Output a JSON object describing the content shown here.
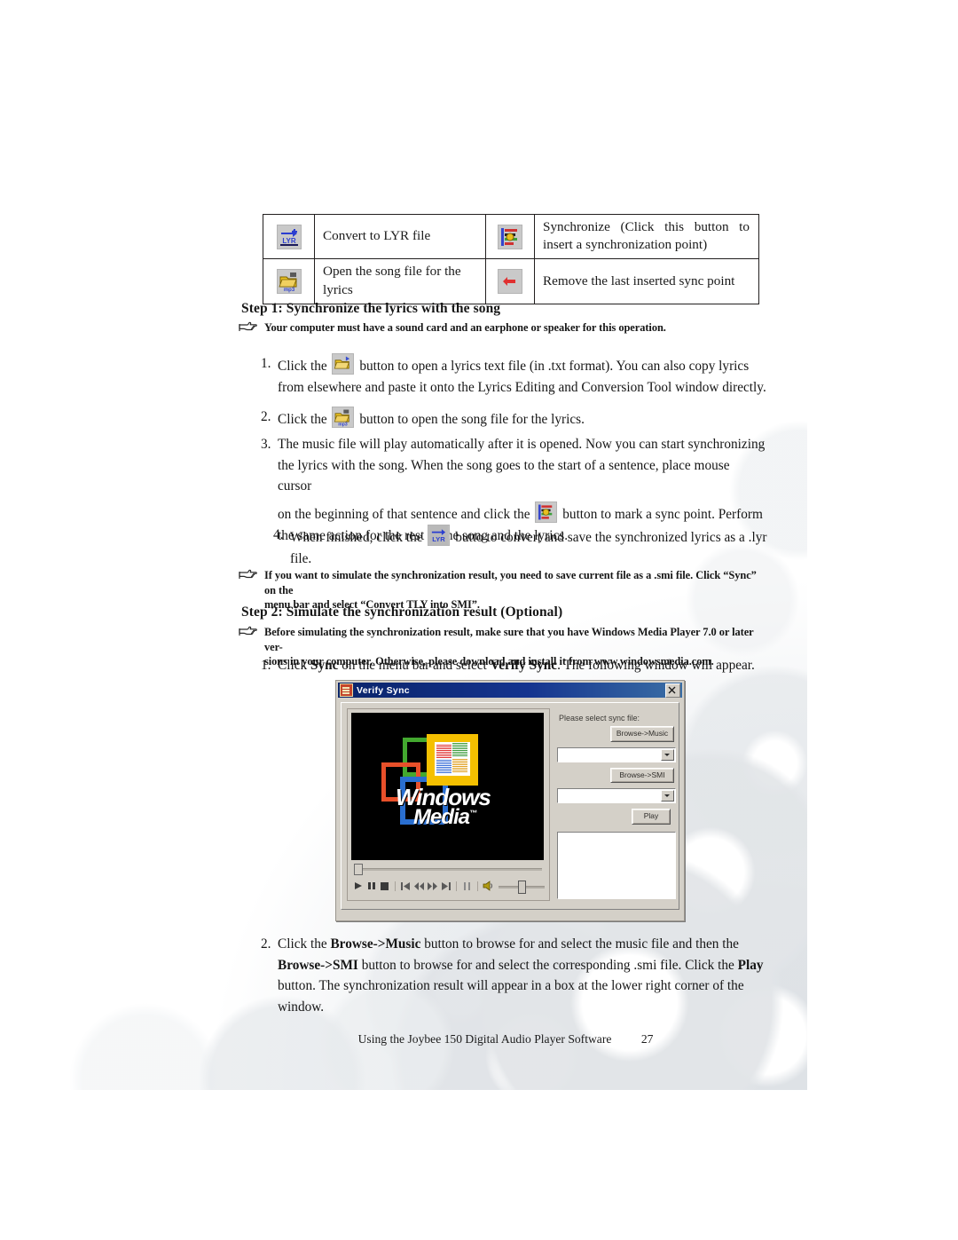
{
  "document": {
    "footer_text": "Using the Joybee 150 Digital Audio Player Software",
    "page_number": "27"
  },
  "icon_table": {
    "rows": [
      {
        "icon_left": "convert-to-lyr-icon",
        "text_left": "Convert to LYR file",
        "icon_right": "synchronize-icon",
        "text_right_line1": "Synchronize (Click this button to",
        "text_right_line2": "insert a synchronization point)"
      },
      {
        "icon_left": "open-song-file-icon",
        "text_left": "Open the song file for the lyrics",
        "icon_right": "remove-sync-point-icon",
        "text_right_line1": "Remove the last inserted sync point",
        "text_right_line2": ""
      }
    ]
  },
  "step1": {
    "heading": "Step 1: Synchronize the lyrics with the song",
    "note": "Your computer must have a sound card and an earphone or speaker for this operation.",
    "items": [
      {
        "num": "1.",
        "pre": "Click the",
        "icon": "open-lyrics-text-file-icon",
        "post_line1": "button to open a lyrics text file (in .txt format). You can also copy lyrics",
        "post_line2": "from elsewhere and paste it onto the Lyrics Editing and Conversion Tool window directly."
      },
      {
        "num": "2.",
        "pre": "Click the",
        "icon": "open-song-file-icon",
        "post_line1": "button to open the song file for the lyrics.",
        "post_line2": ""
      },
      {
        "num": "3.",
        "line1": "The music file will play automatically after it is opened. Now you can start synchronizing",
        "line2": "the lyrics with the song. When the song goes to the start of a sentence, place mouse cursor",
        "line3_pre": "on the beginning of that sentence and click the",
        "icon": "synchronize-icon",
        "line3_post": "button to mark a sync point. Perform",
        "line4": "the same action for the rest of the song and the lyrics."
      },
      {
        "num": "4.",
        "pre": "When finished, click the",
        "icon": "convert-to-lyr-icon",
        "post_line1": "butto to convert and save the synchronized lyrics as a .lyr",
        "post_line2": "file."
      }
    ],
    "note2_line1": "If you want to simulate the synchronization result, you need to save current file as a .smi file. Click “Sync” on the",
    "note2_line2": "menu bar and select “Convert TLY into SMI”."
  },
  "step2": {
    "heading": "Step 2: Simulate the synchronization result (Optional)",
    "note_line1": "Before simulating the synchronization result, make sure that you have Windows Media Player 7.0 or later ver-",
    "note_line2": "sions in your computer. Otherwise, please download and install it from www.windowsmedia.com.",
    "item1": {
      "num": "1.",
      "seg1": "Click ",
      "bold1": "Sync",
      "seg2": " on the menu bar and select ",
      "bold2": "Verify Sync",
      "seg3": ". The following window will appear."
    },
    "item2": {
      "num": "2.",
      "line1_a": "Click the ",
      "line1_b": "Browse->Music",
      "line1_c": " button to browse for and select the music file and then the",
      "line2_a": "Browse->SMI",
      "line2_b": " button to browse for and select the corresponding .smi file. Click the ",
      "line2_c": "Play",
      "line3": "button. The synchronization result will appear in a box at the lower right corner of the",
      "line4": "window."
    }
  },
  "dialog": {
    "title": "Verify Sync",
    "close_icon": "close-icon",
    "media_logo": {
      "line1": "Windows",
      "line2": "Media",
      "trademark": "™"
    },
    "transport": {
      "play": "play-icon",
      "pause": "pause-icon",
      "stop": "stop-icon",
      "previous": "previous-track-icon",
      "rewind": "rewind-icon",
      "forward": "fast-forward-icon",
      "next": "next-track-icon",
      "mute_toggle": "pause-bars-icon",
      "volume": "volume-icon"
    },
    "config": {
      "label": "Please select sync file:",
      "browse_music_button": "Browse->Music",
      "browse_smi_button": "Browse->SMI",
      "play_button": "Play",
      "music_combo_value": "",
      "smi_combo_value": "",
      "result_box_value": ""
    }
  },
  "colors": {
    "dialog_face": "#d4d0c8",
    "titlebar": "#0a246a",
    "media_yellow": "#f5c000",
    "media_green": "#43a82f",
    "media_orange": "#e8502a",
    "media_blue": "#2a6fd1",
    "lyr_blue": "#2b3ed0",
    "remove_red": "#e03030"
  }
}
